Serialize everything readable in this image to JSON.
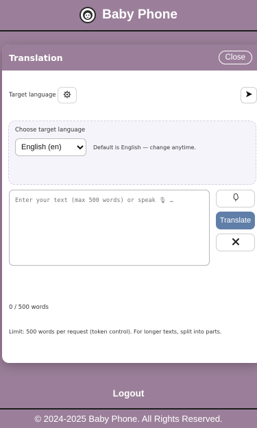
{
  "header": {
    "title": "Baby Phone",
    "logo_icon": "baby-face-icon"
  },
  "modal": {
    "title": "Translation",
    "close_label": "Close",
    "target_language_label": "Target language",
    "settings_icon": "gear-icon",
    "send_icon": "send-arrow-icon",
    "choose_label": "Choose target language",
    "selected_language": "English (en)",
    "language_hint": "Default is English — change anytime.",
    "input_placeholder": "Enter your text (max 500 words) or speak 🎙 …",
    "mic_icon": "microphone-icon",
    "translate_label": "Translate",
    "clear_icon": "clear-x-icon",
    "word_count": "0 / 500 words",
    "limit_note": "Limit: 500 words per request (token control). For longer texts, split into parts."
  },
  "footer": {
    "logout_label": "Logout",
    "copyright": "© 2024-2025 Baby Phone. All Rights Reserved."
  },
  "colors": {
    "brand": "#9b7f9a",
    "translate_button": "#5f7ea8",
    "language_box": "#f6f4fb"
  }
}
